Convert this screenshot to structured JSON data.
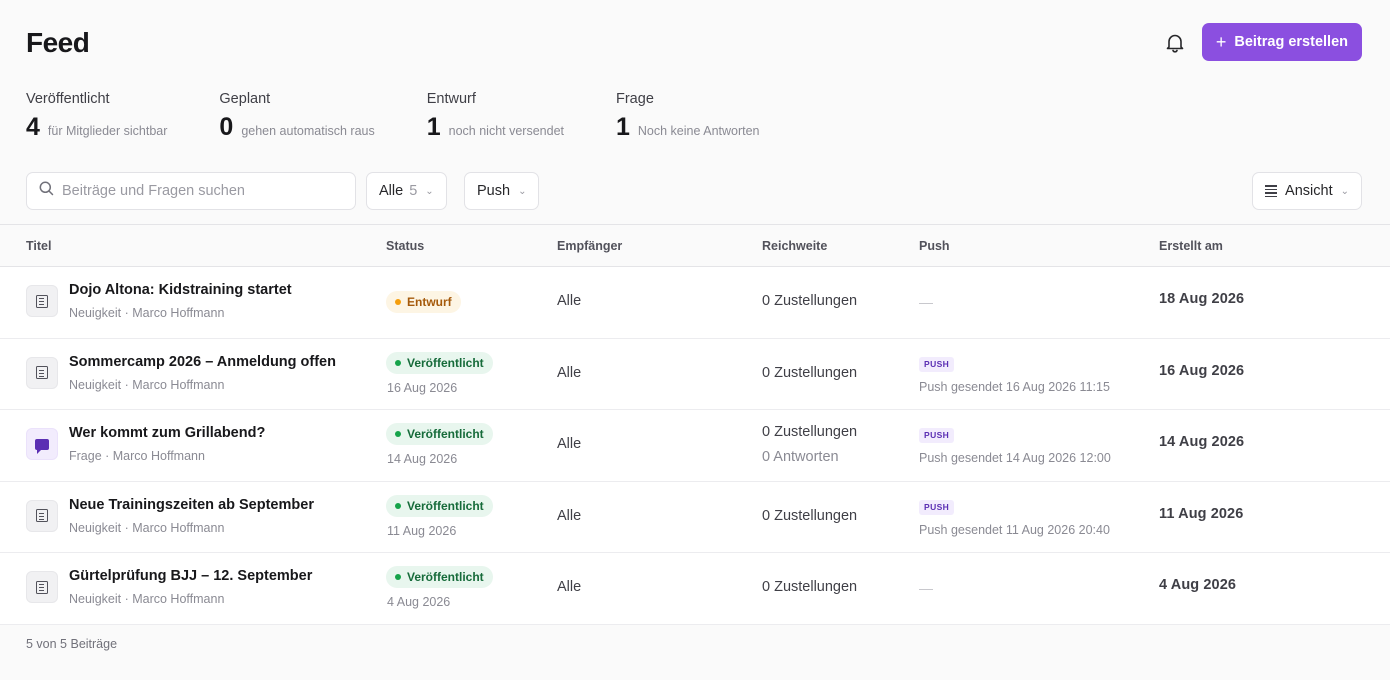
{
  "header": {
    "title": "Feed",
    "notification_icon": "bell-icon",
    "create_button_label": "Beitrag erstellen",
    "create_button_icon": "plus-icon",
    "accent_color": "#8b4fe0"
  },
  "stats": [
    {
      "label": "Veröffentlicht",
      "value": "4",
      "hint": "für Mitglieder sichtbar"
    },
    {
      "label": "Geplant",
      "value": "0",
      "hint": "gehen automatisch raus"
    },
    {
      "label": "Entwurf",
      "value": "1",
      "hint": "noch nicht versendet"
    },
    {
      "label": "Frage",
      "value": "1",
      "hint": "Noch keine Antworten"
    }
  ],
  "toolbar": {
    "search_placeholder": "Beiträge und Fragen suchen",
    "filter_type_label": "Alle",
    "filter_type_count": "5",
    "filter_push_label": "Push",
    "view_label": "Ansicht"
  },
  "table": {
    "columns": [
      "Titel",
      "Status",
      "Empfänger",
      "Reichweite",
      "Push",
      "Erstellt am"
    ],
    "rows": [
      {
        "icon": "document-icon",
        "title": "Dojo Altona: Kidstraining startet",
        "meta": "Neuigkeit · Marco Hoffmann",
        "status": "Entwurf",
        "status_kind": "draft",
        "status_date": "",
        "recipients": "Alle",
        "reach": "0 Zustellungen",
        "reach_sub": "",
        "push_tag": "",
        "push_text": "—",
        "created": "18 Aug 2026"
      },
      {
        "icon": "document-icon",
        "title": "Sommercamp 2026 – Anmeldung offen",
        "meta": "Neuigkeit · Marco Hoffmann",
        "status": "Veröffentlicht",
        "status_kind": "published",
        "status_date": "16 Aug 2026",
        "recipients": "Alle",
        "reach": "0 Zustellungen",
        "reach_sub": "",
        "push_tag": "PUSH",
        "push_text": "Push gesendet 16 Aug 2026 11:15",
        "created": "16 Aug 2026"
      },
      {
        "icon": "chat-bubble-icon",
        "title": "Wer kommt zum Grillabend?",
        "meta": "Frage · Marco Hoffmann",
        "status": "Veröffentlicht",
        "status_kind": "published",
        "status_date": "14 Aug 2026",
        "recipients": "Alle",
        "reach": "0 Zustellungen",
        "reach_sub": "0 Antworten",
        "push_tag": "PUSH",
        "push_text": "Push gesendet 14 Aug 2026 12:00",
        "created": "14 Aug 2026"
      },
      {
        "icon": "document-icon",
        "title": "Neue Trainingszeiten ab September",
        "meta": "Neuigkeit · Marco Hoffmann",
        "status": "Veröffentlicht",
        "status_kind": "published",
        "status_date": "11 Aug 2026",
        "recipients": "Alle",
        "reach": "0 Zustellungen",
        "reach_sub": "",
        "push_tag": "PUSH",
        "push_text": "Push gesendet 11 Aug 2026 20:40",
        "created": "11 Aug 2026"
      },
      {
        "icon": "document-icon",
        "title": "Gürtelprüfung BJJ – 12. September",
        "meta": "Neuigkeit · Marco Hoffmann",
        "status": "Veröffentlicht",
        "status_kind": "published",
        "status_date": "4 Aug 2026",
        "recipients": "Alle",
        "reach": "0 Zustellungen",
        "reach_sub": "",
        "push_tag": "",
        "push_text": "—",
        "created": "4 Aug 2026"
      }
    ]
  },
  "footer": {
    "count_text": "5 von 5 Beiträge"
  }
}
